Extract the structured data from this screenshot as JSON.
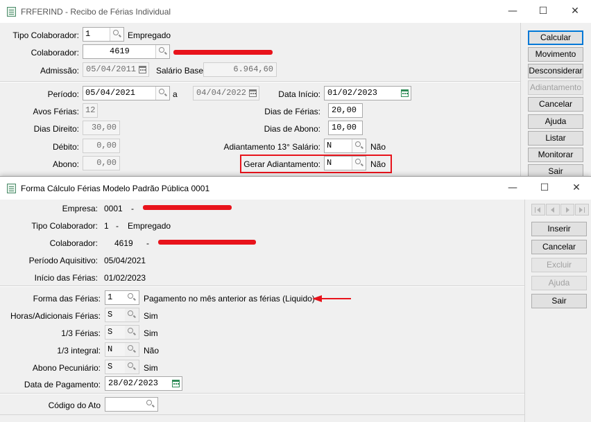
{
  "back_window": {
    "title": "FRFERIND - Recibo de Férias Individual",
    "controls": {
      "minimize": "—",
      "maximize": "☐",
      "close": "✕"
    },
    "tipo_colaborador": {
      "label": "Tipo Colaborador:",
      "value": "1",
      "desc": "Empregado"
    },
    "colaborador": {
      "label": "Colaborador:",
      "value": "4619"
    },
    "admissao": {
      "label": "Admissão:",
      "value": "05/04/2011"
    },
    "salario_base": {
      "label": "Salário Base:",
      "value": "6.964,60"
    },
    "periodo": {
      "label": "Período:",
      "start": "05/04/2021",
      "sep": "a",
      "end": "04/04/2022"
    },
    "data_inicio": {
      "label": "Data Início:",
      "value": "01/02/2023"
    },
    "avos_ferias": {
      "label": "Avos Férias:",
      "value": "12"
    },
    "dias_ferias": {
      "label": "Dias de Férias:",
      "value": "20,00"
    },
    "dias_direito": {
      "label": "Dias Direito:",
      "value": "30,00"
    },
    "dias_abono": {
      "label": "Dias de Abono:",
      "value": "10,00"
    },
    "debito": {
      "label": "Débito:",
      "value": "0,00"
    },
    "adiantamento_13": {
      "label": "Adiantamento 13° Salário:",
      "value": "N",
      "desc": "Não"
    },
    "abono": {
      "label": "Abono:",
      "value": "0,00"
    },
    "gerar_adiantamento": {
      "label": "Gerar Adiantamento:",
      "value": "N",
      "desc": "Não"
    },
    "buttons": {
      "calcular": "Calcular",
      "movimento": "Movimento",
      "desconsiderar": "Desconsiderar",
      "adiantamento": "Adiantamento",
      "cancelar": "Cancelar",
      "ajuda": "Ajuda",
      "listar": "Listar",
      "monitorar": "Monitorar",
      "sair": "Sair"
    }
  },
  "front_window": {
    "title": "Forma Cálculo Férias Modelo Padrão Pública 0001",
    "controls": {
      "minimize": "—",
      "maximize": "☐",
      "close": "✕"
    },
    "empresa": {
      "label": "Empresa:",
      "code": "0001",
      "dash": "-"
    },
    "tipo_colaborador": {
      "label": "Tipo Colaborador:",
      "code": "1",
      "dash": "-",
      "desc": "Empregado"
    },
    "colaborador": {
      "label": "Colaborador:",
      "code": "4619",
      "dash": "-"
    },
    "periodo_aquisitivo": {
      "label": "Período Aquisitivo:",
      "value": "05/04/2021"
    },
    "inicio_ferias": {
      "label": "Início das Férias:",
      "value": "01/02/2023"
    },
    "forma_ferias": {
      "label": "Forma das Férias:",
      "value": "1",
      "desc": "Pagamento no mês anterior as férias (Liquido)"
    },
    "horas_adicionais": {
      "label": "Horas/Adicionais Férias:",
      "value": "S",
      "desc": "Sim"
    },
    "um_terco_ferias": {
      "label": "1/3 Férias:",
      "value": "S",
      "desc": "Sim"
    },
    "um_terco_integral": {
      "label": "1/3 integral:",
      "value": "N",
      "desc": "Não"
    },
    "abono_pecuniario": {
      "label": "Abono Pecuniário:",
      "value": "S",
      "desc": "Sim"
    },
    "data_pagamento": {
      "label": "Data de Pagamento:",
      "value": "28/02/2023"
    },
    "codigo_ato": {
      "label": "Código do Ato",
      "value": ""
    },
    "buttons": {
      "inserir": "Inserir",
      "cancelar": "Cancelar",
      "excluir": "Excluir",
      "ajuda": "Ajuda",
      "sair": "Sair"
    }
  },
  "colors": {
    "highlight": "#e8131b",
    "default_button_border": "#0078d7"
  }
}
